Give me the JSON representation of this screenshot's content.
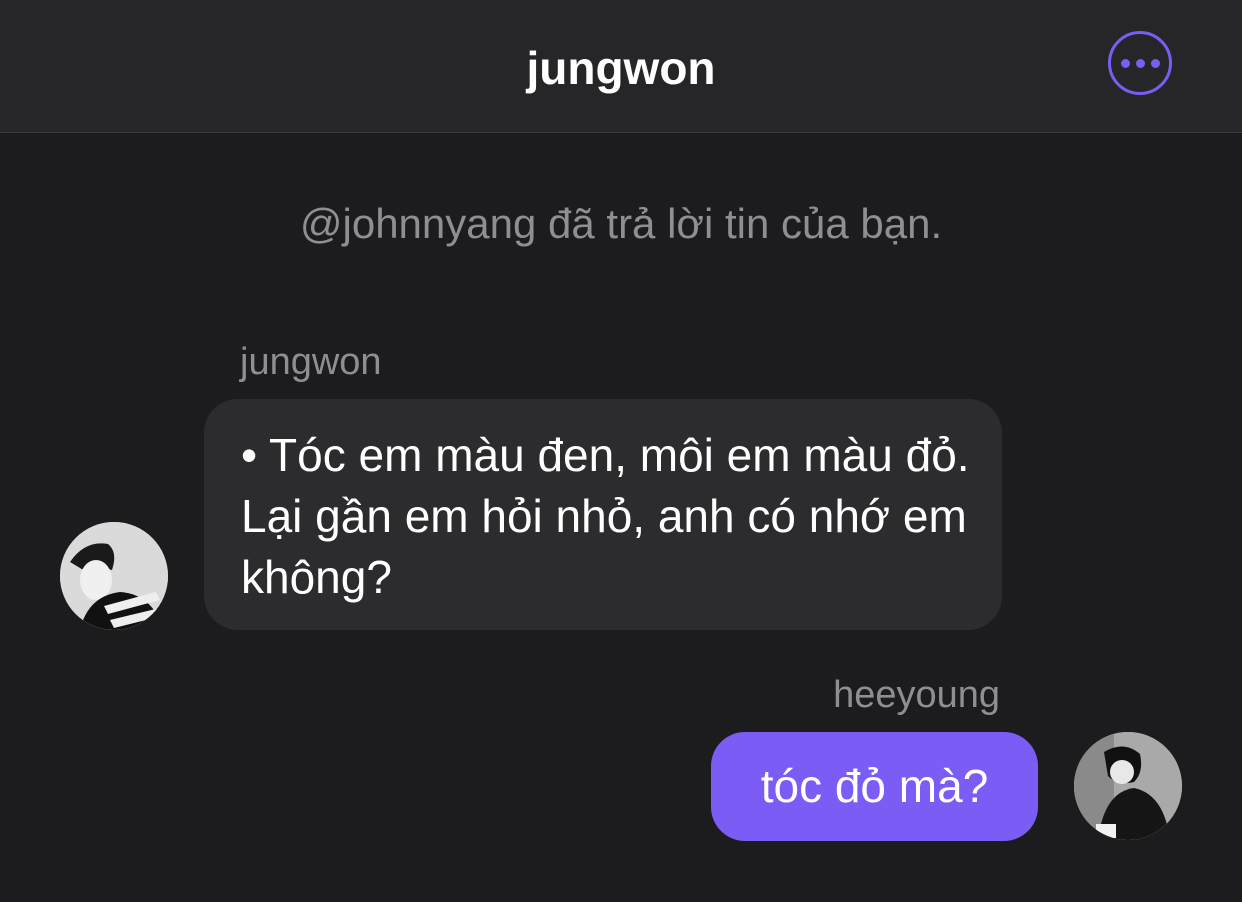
{
  "header": {
    "title": "jungwon",
    "more_icon": "ellipsis-circle-icon",
    "accent_color": "#7b5cf5"
  },
  "system_note": "@johnnyang đã trả lời tin của bạn.",
  "messages": [
    {
      "sender": "jungwon",
      "direction": "incoming",
      "text": "• Tóc em màu đen, môi em màu đỏ. Lại gần em hỏi nhỏ, anh có nhớ em không?"
    },
    {
      "sender": "heeyoung",
      "direction": "outgoing",
      "text": "tóc đỏ mà?"
    }
  ]
}
